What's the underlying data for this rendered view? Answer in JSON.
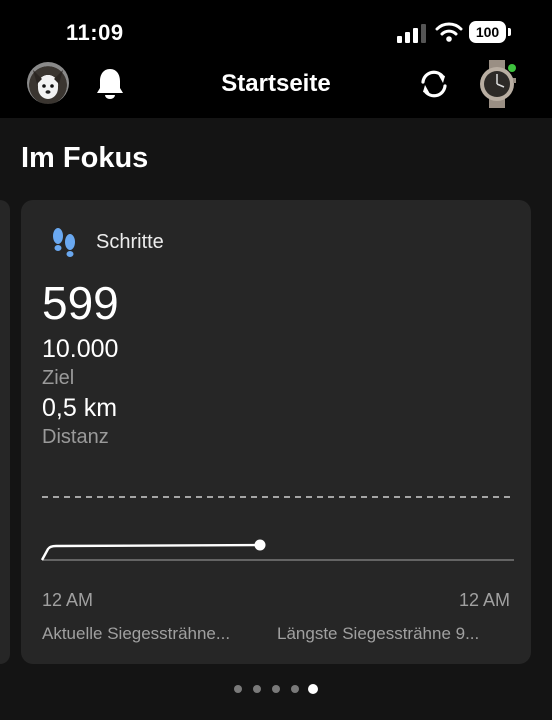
{
  "status_bar": {
    "time": "11:09",
    "battery": "100"
  },
  "header": {
    "title": "Startseite"
  },
  "section": {
    "title": "Im Fokus"
  },
  "card": {
    "title": "Schritte",
    "steps": "599",
    "goal_value": "10.000",
    "goal_label": "Ziel",
    "distance_value": "0,5 km",
    "distance_label": "Distanz",
    "time_start": "12 AM",
    "time_end": "12 AM",
    "streak_current": "Aktuelle Siegessträhne...",
    "streak_longest": "Längste Siegessträhne 9..."
  },
  "pager": {
    "count": 5,
    "active_index": 4
  },
  "colors": {
    "accent_blue": "#6aa8f0",
    "online_green": "#3ec23e"
  },
  "icons": [
    "bell-icon",
    "sync-icon",
    "footsteps-icon",
    "watch-icon",
    "signal-icon",
    "wifi-icon",
    "battery-icon"
  ]
}
